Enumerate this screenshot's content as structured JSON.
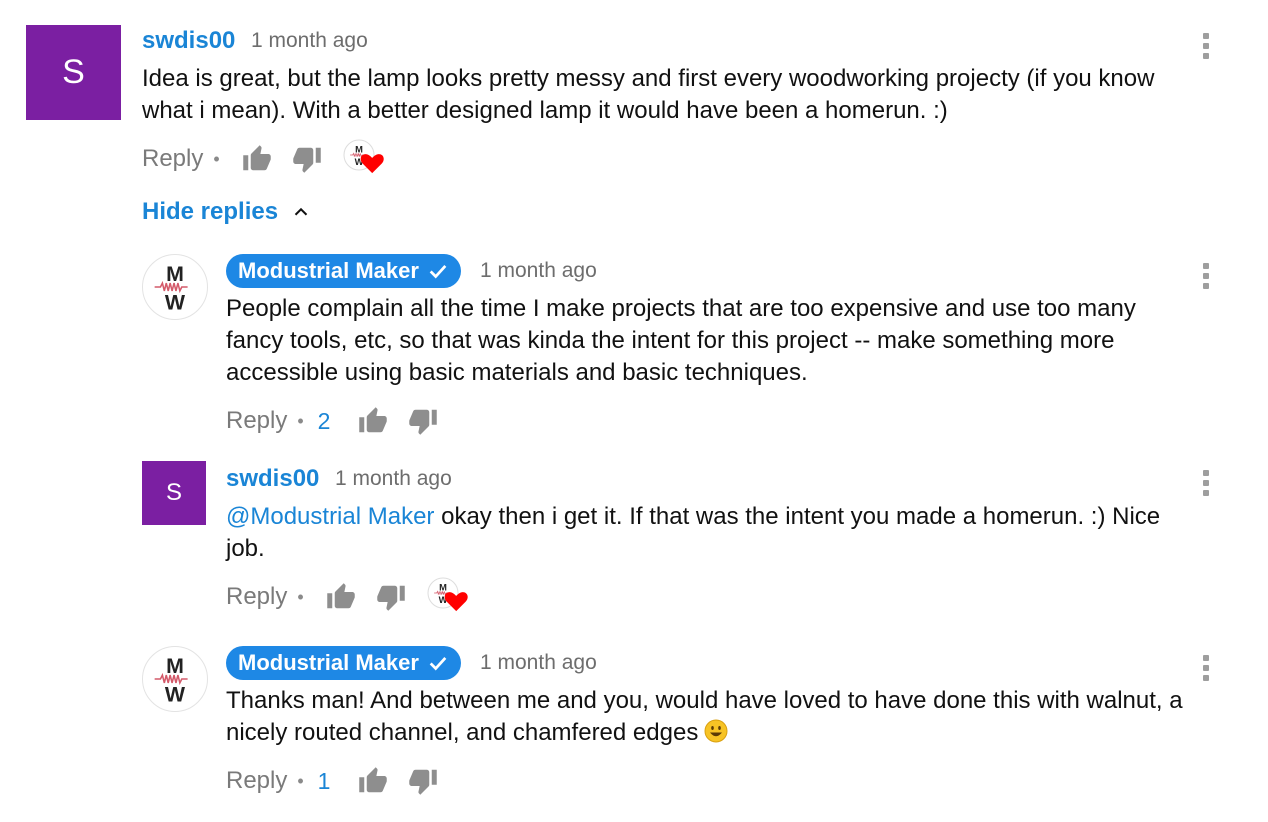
{
  "comments": [
    {
      "author": "swdis00",
      "avatar_letter": "S",
      "time": "1 month ago",
      "text": "Idea is great, but the lamp looks pretty messy and first every woodworking projecty (if you know what i mean). With a better designed lamp it would have been a homerun. :)",
      "reply_label": "Reply",
      "hearted": true
    },
    {
      "author": "Modustrial Maker",
      "verified": true,
      "time": "1 month ago",
      "text": "People complain all the time I make projects that are too expensive and use too many fancy tools, etc, so that was kinda the intent for this project -- make something more accessible using basic materials and basic techniques.",
      "reply_label": "Reply",
      "likes": "2"
    },
    {
      "author": "swdis00",
      "avatar_letter": "S",
      "time": "1 month ago",
      "mention": "@Modustrial Maker",
      "text": " okay then i get it. If that was the intent you made a homerun. :) Nice job.",
      "reply_label": "Reply",
      "hearted": true
    },
    {
      "author": "Modustrial Maker",
      "verified": true,
      "time": "1 month ago",
      "text": "Thanks man!  And between me and you, would have loved to have done this with walnut, a nicely routed channel, and chamfered edges",
      "emoji": "smiley-emoji",
      "reply_label": "Reply",
      "likes": "1"
    }
  ],
  "hide_replies_label": "Hide replies",
  "creator_avatar_letters": [
    "M",
    "W"
  ],
  "colors": {
    "link": "#1a85d6",
    "badge": "#1e88e5",
    "avatar": "#7b1fa2",
    "heart": "#ff0000",
    "secondary_text": "#6d6d6d"
  },
  "icons": [
    "like-icon",
    "dislike-icon",
    "heart-icon",
    "more-vert-icon",
    "chevron-up-icon",
    "verified-check-icon"
  ]
}
